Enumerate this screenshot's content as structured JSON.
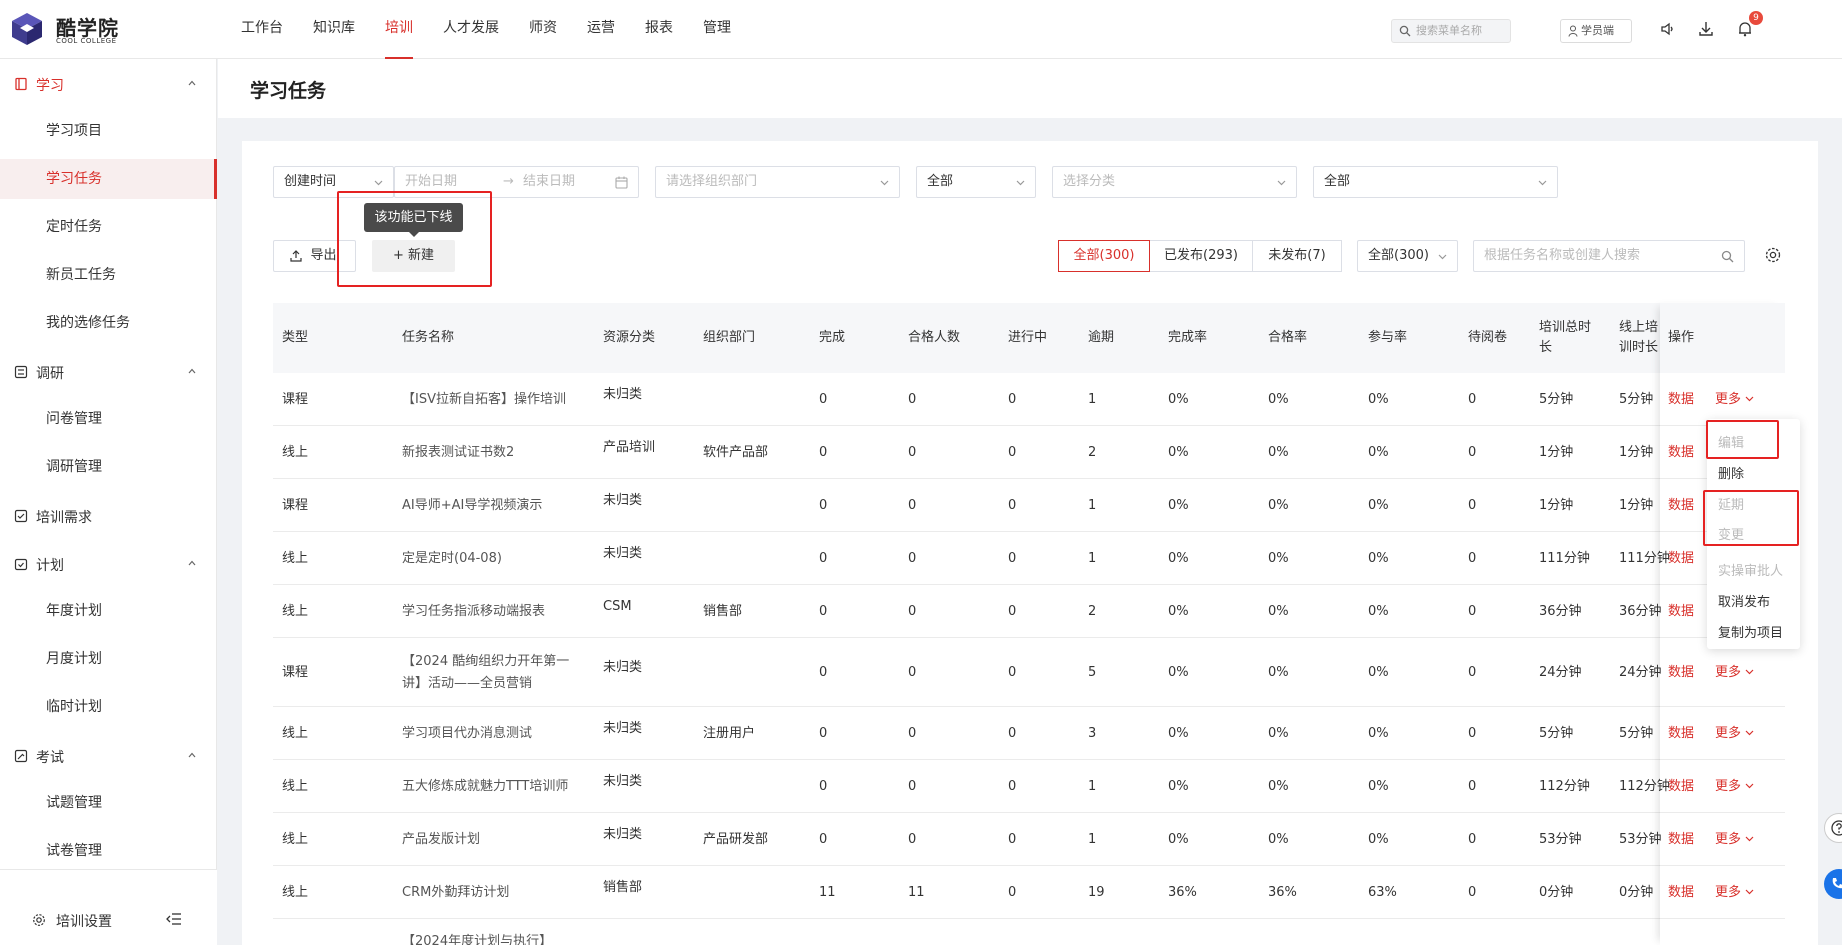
{
  "brand": {
    "name_cn": "酷学院",
    "name_en": "COOL COLLEGE"
  },
  "nav": [
    "工作台",
    "知识库",
    "培训",
    "人才发展",
    "师资",
    "运营",
    "报表",
    "管理"
  ],
  "nav_active": 2,
  "top": {
    "search_placeholder": "搜索菜单名称",
    "student_label": "学员端",
    "notif_count": "9"
  },
  "sidebar": {
    "groups": [
      {
        "label": "学习",
        "icon": "book-icon",
        "expanded": true,
        "active": true
      },
      {
        "label": "调研",
        "icon": "survey-icon",
        "expanded": true
      },
      {
        "label": "培训需求",
        "icon": "checklist-icon",
        "expanded": false
      },
      {
        "label": "计划",
        "icon": "calendar-icon",
        "expanded": true
      },
      {
        "label": "考试",
        "icon": "exam-icon",
        "expanded": true
      }
    ],
    "items": [
      "学习项目",
      "学习任务",
      "定时任务",
      "新员工任务",
      "我的选修任务",
      "问卷管理",
      "调研管理",
      "年度计划",
      "月度计划",
      "临时计划",
      "试题管理",
      "试卷管理"
    ],
    "active_item": 1,
    "footer": "培训设置"
  },
  "page": {
    "title": "学习任务"
  },
  "filters": {
    "time_type": "创建时间",
    "start_placeholder": "开始日期",
    "range_arrow": "→",
    "end_placeholder": "结束日期",
    "dept_placeholder": "请选择组织部门",
    "select1": "全部",
    "category_placeholder": "选择分类",
    "select2": "全部"
  },
  "actions": {
    "export": "导出",
    "new": "+ 新建",
    "tooltip": "该功能已下线"
  },
  "status_tabs": [
    "全部(300)",
    "已发布(293)",
    "未发布(7)"
  ],
  "status_active": 0,
  "type_select": "全部(300)",
  "search_placeholder": "根据任务名称或创建人搜索",
  "table": {
    "headers": [
      "类型",
      "任务名称",
      "资源分类",
      "组织部门",
      "完成",
      "合格人数",
      "进行中",
      "逾期",
      "完成率",
      "合格率",
      "参与率",
      "待阅卷",
      "培训总时长",
      "线上培训时长",
      "操作"
    ],
    "rows": [
      [
        "课程",
        "【ISV拉新自拓客】操作培训",
        "未归类",
        "",
        "0",
        "0",
        "0",
        "1",
        "0%",
        "0%",
        "0%",
        "0",
        "5分钟",
        "5分钟"
      ],
      [
        "线上",
        "新报表测试证书数2",
        "产品培训",
        "软件产品部",
        "0",
        "0",
        "0",
        "2",
        "0%",
        "0%",
        "0%",
        "0",
        "1分钟",
        "1分钟"
      ],
      [
        "课程",
        "AI导师+AI导学视频演示",
        "未归类",
        "",
        "0",
        "0",
        "0",
        "1",
        "0%",
        "0%",
        "0%",
        "0",
        "1分钟",
        "1分钟"
      ],
      [
        "线上",
        "定是定时(04-08)",
        "未归类",
        "",
        "0",
        "0",
        "0",
        "1",
        "0%",
        "0%",
        "0%",
        "0",
        "111分钟",
        "111分钟"
      ],
      [
        "线上",
        "学习任务指派移动端报表",
        "CSM",
        "销售部",
        "0",
        "0",
        "0",
        "2",
        "0%",
        "0%",
        "0%",
        "0",
        "36分钟",
        "36分钟"
      ],
      [
        "课程",
        "【2024 酷绚组织力开年第一讲】活动——全员营销",
        "未归类",
        "",
        "0",
        "0",
        "0",
        "5",
        "0%",
        "0%",
        "0%",
        "0",
        "24分钟",
        "24分钟"
      ],
      [
        "线上",
        "学习项目代办消息测试",
        "未归类",
        "注册用户",
        "0",
        "0",
        "0",
        "3",
        "0%",
        "0%",
        "0%",
        "0",
        "5分钟",
        "5分钟"
      ],
      [
        "线上",
        "五大修炼成就魅力TTT培训师",
        "未归类",
        "",
        "0",
        "0",
        "0",
        "1",
        "0%",
        "0%",
        "0%",
        "0",
        "112分钟",
        "112分钟"
      ],
      [
        "线上",
        "产品发版计划",
        "未归类",
        "产品研发部",
        "0",
        "0",
        "0",
        "1",
        "0%",
        "0%",
        "0%",
        "0",
        "53分钟",
        "53分钟"
      ],
      [
        "线上",
        "CRM外勤拜访计划",
        "销售部",
        "",
        "11",
        "11",
        "0",
        "19",
        "36%",
        "36%",
        "63%",
        "0",
        "0分钟",
        "0分钟"
      ],
      [
        "",
        "【2024年度计划与执行】",
        "",
        "",
        "",
        "",
        "",
        "",
        "",
        "",
        "",
        "",
        "",
        ""
      ]
    ],
    "op_data": "数据",
    "op_more": "更多"
  },
  "more_menu": [
    {
      "label": "编辑",
      "disabled": true
    },
    {
      "label": "删除",
      "disabled": false
    },
    {
      "label": "延期",
      "disabled": true
    },
    {
      "label": "变更",
      "disabled": true
    },
    {
      "label": "实操审批人",
      "disabled": true
    },
    {
      "label": "取消发布",
      "disabled": false
    },
    {
      "label": "复制为项目",
      "disabled": false
    }
  ],
  "colors": {
    "accent": "#d8302b",
    "highlight_box": "#e52222",
    "brand_purple": "#3f3c8e"
  }
}
